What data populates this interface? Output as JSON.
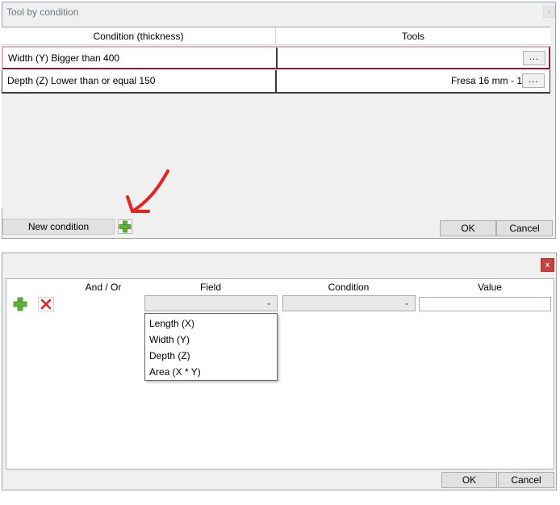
{
  "dialog1": {
    "title": "Tool by condition",
    "close_label": "x",
    "columns": {
      "condition": "Condition (thickness)",
      "tools": "Tools"
    },
    "rows": [
      {
        "condition": "Width (Y) Bigger than 400",
        "tool": "",
        "browse": "..."
      },
      {
        "condition": "Depth (Z) Lower than or equal 150",
        "tool": "Fresa 16 mm - 1",
        "browse": "..."
      }
    ],
    "new_condition_label": "New condition",
    "ok_label": "OK",
    "cancel_label": "Cancel",
    "annotation_arrow_color": "#e8231d"
  },
  "dialog2": {
    "close_label": "x",
    "columns": {
      "and_or": "And / Or",
      "field": "Field",
      "condition": "Condition",
      "value": "Value"
    },
    "field_selected": "",
    "condition_selected": "",
    "value_input": "",
    "field_options": [
      "Length (X)",
      "Width (Y)",
      "Depth (Z)",
      "Area (X * Y)"
    ],
    "ok_label": "OK",
    "cancel_label": "Cancel"
  },
  "icons": {
    "add": "green-plus-icon",
    "delete": "red-x-icon",
    "dropdown": "chevron-down-icon"
  },
  "colors": {
    "add_green": "#5fb336",
    "delete_red": "#e0242a",
    "close_red": "#c7413f"
  }
}
